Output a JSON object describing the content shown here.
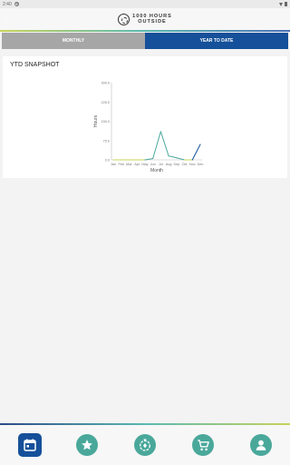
{
  "status": {
    "time": "2:40",
    "g_badge": "G"
  },
  "header": {
    "logo_line1": "1000 HOURS",
    "logo_line2": "OUTSIDE",
    "back_glyph": "←"
  },
  "tabs": [
    {
      "label": "MONTHLY",
      "active": false
    },
    {
      "label": "YEAR TO DATE",
      "active": true
    }
  ],
  "snapshot": {
    "title": "YTD SNAPSHOT"
  },
  "chart_data": {
    "type": "line",
    "xlabel": "Month",
    "ylabel": "Hours",
    "categories": [
      "Jan",
      "Feb",
      "Mar",
      "Apr",
      "May",
      "Jun",
      "Jul",
      "Aug",
      "Sep",
      "Oct",
      "Nov",
      "Dec"
    ],
    "values": [
      0,
      0,
      0,
      0,
      0,
      5,
      110,
      15,
      8,
      0,
      0,
      60
    ],
    "ylim": [
      0,
      300
    ],
    "yticks": [
      "300.0",
      "225.0",
      "150.0",
      "75.0",
      "0.0"
    ],
    "grid": false,
    "colors": {
      "low": "#c8d35a",
      "mid": "#4aa89b",
      "high": "#16509a"
    }
  },
  "bottom_nav": [
    {
      "name": "calendar-icon",
      "active": true
    },
    {
      "name": "star-icon",
      "active": false
    },
    {
      "name": "timer-icon",
      "active": false
    },
    {
      "name": "cart-icon",
      "active": false
    },
    {
      "name": "user-icon",
      "active": false
    }
  ],
  "colors": {
    "primary": "#16509a",
    "accent": "#4aa89b",
    "inactive_tab": "#a6a6a6"
  }
}
